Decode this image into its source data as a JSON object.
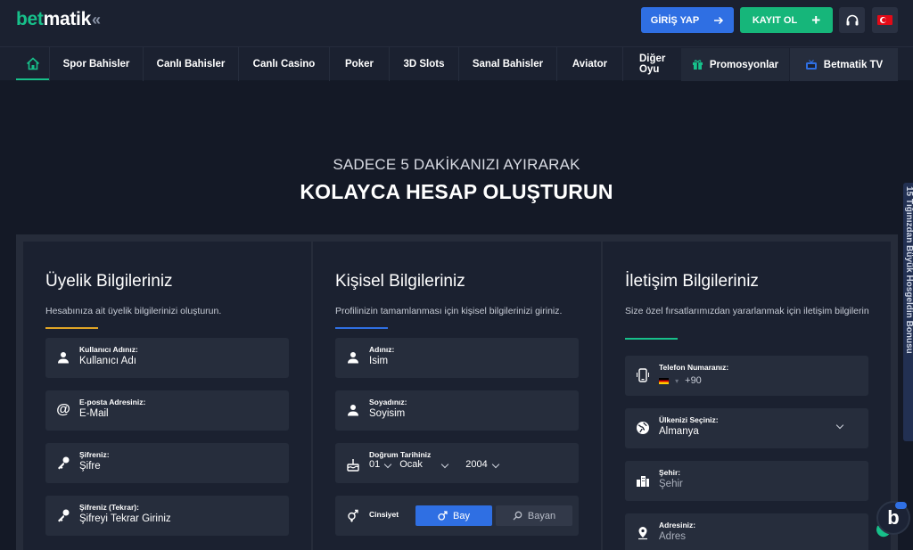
{
  "header": {
    "logo_main": "betmatik",
    "logo_chevrons": "«",
    "login_label": "GİRİŞ YAP",
    "register_label": "KAYIT OL",
    "register_plus": "+"
  },
  "nav": {
    "items": [
      "Spor Bahisler",
      "Canlı Bahisler",
      "Canlı Casino",
      "Poker",
      "3D Slots",
      "Sanal Bahisler",
      "Aviator",
      "Diğer Oyu"
    ],
    "promo_label": "Promosyonlar",
    "tv_label": "Betmatik TV"
  },
  "hero": {
    "subtitle": "SADECE 5 DAKİKANIZI AYIRARAK",
    "title": "KOLAYCA HESAP OLUŞTURUN"
  },
  "side_tab": {
    "label": "15 Tığınızdan Büyük Hosgeldin Bonusu"
  },
  "membership": {
    "title": "Üyelik Bilgileriniz",
    "description": "Hesabınıza ait üyelik bilgilerinizi oluşturun.",
    "accent_color": "#e0a526",
    "fields": [
      {
        "label": "Kullanıcı Adınız:",
        "value": "Kullanıcı Adı"
      },
      {
        "label": "E-posta Adresiniz:",
        "value": "E-Mail"
      },
      {
        "label": "Şifreniz:",
        "value": "Şifre"
      },
      {
        "label": "Şifreniz (Tekrar):",
        "value": "Şifreyi Tekrar Giriniz"
      }
    ]
  },
  "personal": {
    "title": "Kişisel Bilgileriniz",
    "description": "Profilinizin tamamlanması için kişisel bilgilerinizi giriniz.",
    "accent_color": "#2f6fe3",
    "name": {
      "label": "Adınız:",
      "value": "Isim"
    },
    "surname": {
      "label": "Soyadınız:",
      "value": "Soyisim"
    },
    "birth": {
      "label": "Doğrum Tarihiniz",
      "day": "01",
      "month": "Ocak",
      "year": "2004"
    },
    "gender": {
      "label": "Cinsiyet",
      "male": "Bay",
      "female": "Bayan",
      "selected": "Bay"
    }
  },
  "contact": {
    "title": "İletişim Bilgileriniz",
    "description": "Size özel fırsatlarımızdan yararlanmak için iletişim bilgilerin",
    "accent_color": "#17c08a",
    "phone": {
      "label": "Telefon Numaranız:",
      "prefix": "+90"
    },
    "country": {
      "label": "Ülkenizi Seçiniz:",
      "value": "Almanya"
    },
    "city": {
      "label": "Şehir:",
      "value": "Şehir"
    },
    "address": {
      "label": "Adresiniz:",
      "value": "Adres"
    }
  },
  "colors": {
    "login_button": "#2f6fe3",
    "register_button": "#16b67a",
    "background": "#141926"
  },
  "icons": [
    "home-icon",
    "arrow-right-icon",
    "plus-icon",
    "headset-icon",
    "turkey-flag-icon",
    "gift-icon",
    "tv-icon",
    "user-icon",
    "at-icon",
    "key-icon",
    "cake-icon",
    "gender-icon",
    "mobile-phone-icon",
    "globe-icon",
    "city-icon",
    "location-pin-icon",
    "chevron-down-icon",
    "male-icon",
    "female-icon",
    "chat-icon"
  ]
}
